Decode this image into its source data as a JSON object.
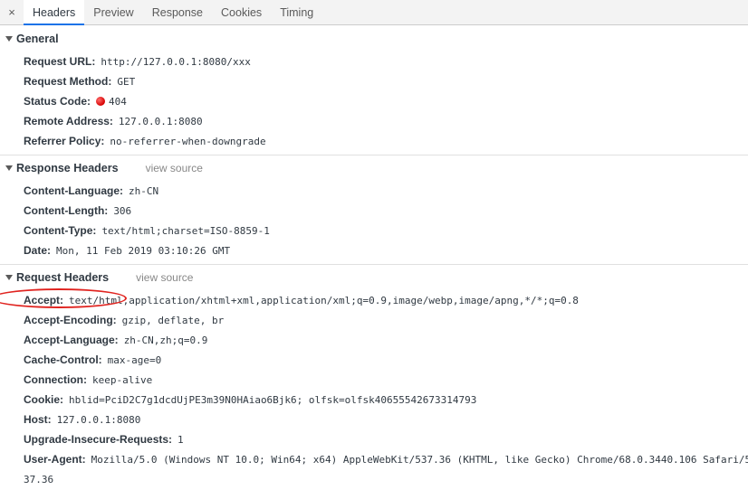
{
  "tabs": {
    "close": "×",
    "items": [
      "Headers",
      "Preview",
      "Response",
      "Cookies",
      "Timing"
    ]
  },
  "general": {
    "title": "General",
    "rows": [
      {
        "k": "Request URL:",
        "v": "http://127.0.0.1:8080/xxx"
      },
      {
        "k": "Request Method:",
        "v": "GET"
      },
      {
        "k": "Status Code:",
        "v": "404"
      },
      {
        "k": "Remote Address:",
        "v": "127.0.0.1:8080"
      },
      {
        "k": "Referrer Policy:",
        "v": "no-referrer-when-downgrade"
      }
    ]
  },
  "response": {
    "title": "Response Headers",
    "view_source": "view source",
    "rows": [
      {
        "k": "Content-Language:",
        "v": "zh-CN"
      },
      {
        "k": "Content-Length:",
        "v": "306"
      },
      {
        "k": "Content-Type:",
        "v": "text/html;charset=ISO-8859-1"
      },
      {
        "k": "Date:",
        "v": "Mon, 11 Feb 2019 03:10:26 GMT"
      }
    ]
  },
  "request": {
    "title": "Request Headers",
    "view_source": "view source",
    "rows": [
      {
        "k": "Accept:",
        "v": "text/html,application/xhtml+xml,application/xml;q=0.9,image/webp,image/apng,*/*;q=0.8"
      },
      {
        "k": "Accept-Encoding:",
        "v": "gzip, deflate, br"
      },
      {
        "k": "Accept-Language:",
        "v": "zh-CN,zh;q=0.9"
      },
      {
        "k": "Cache-Control:",
        "v": "max-age=0"
      },
      {
        "k": "Connection:",
        "v": "keep-alive"
      },
      {
        "k": "Cookie:",
        "v": "hblid=PciD2C7g1dcdUjPE3m39N0HAiao6Bjk6; olfsk=olfsk40655542673314793"
      },
      {
        "k": "Host:",
        "v": "127.0.0.1:8080"
      },
      {
        "k": "Upgrade-Insecure-Requests:",
        "v": "1"
      },
      {
        "k": "User-Agent:",
        "v": "Mozilla/5.0 (Windows NT 10.0; Win64; x64) AppleWebKit/537.36 (KHTML, like Gecko) Chrome/68.0.3440.106 Safari/5"
      }
    ],
    "ua_continuation": "37.36"
  },
  "colors": {
    "status_dot": "#d60000",
    "annotation_oval": "#e0231f",
    "tab_underline": "#1a73e8"
  }
}
